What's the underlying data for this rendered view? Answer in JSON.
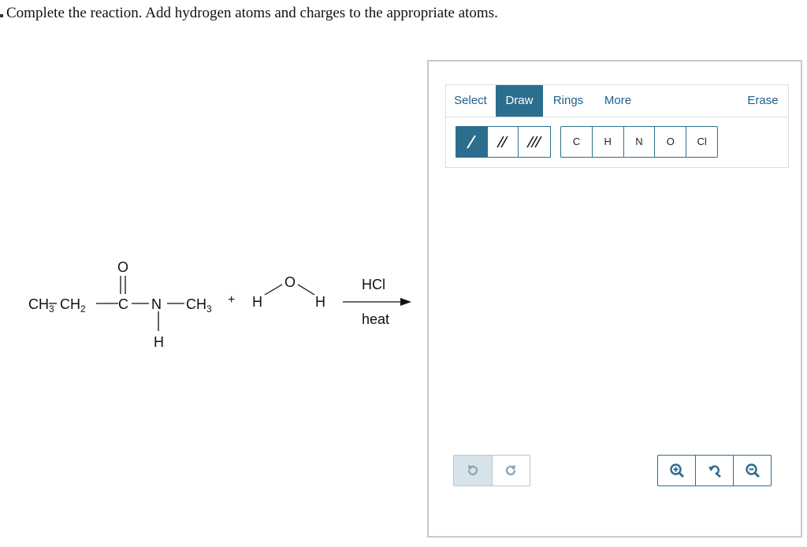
{
  "question": {
    "prompt": "Complete the reaction. Add hydrogen atoms and charges to the appropriate atoms."
  },
  "reaction": {
    "reactant1": {
      "ch3_a": "CH",
      "ch3_a_sub": "3",
      "ch2": "CH",
      "ch2_sub": "2",
      "carbon": "C",
      "oxygen": "O",
      "nitrogen": "N",
      "ch3_b": "CH",
      "ch3_b_sub": "3",
      "n_hydrogen": "H"
    },
    "plus": "+",
    "water": {
      "h_left": "H",
      "oxygen": "O",
      "h_right": "H"
    },
    "reagent_above": "HCl",
    "reagent_below": "heat"
  },
  "editor": {
    "tabs": [
      {
        "label": "Select",
        "active": false
      },
      {
        "label": "Draw",
        "active": true
      },
      {
        "label": "Rings",
        "active": false
      },
      {
        "label": "More",
        "active": false
      }
    ],
    "erase_label": "Erase",
    "bonds": [
      {
        "icon": "single-bond-icon",
        "active": true
      },
      {
        "icon": "double-bond-icon",
        "active": false
      },
      {
        "icon": "triple-bond-icon",
        "active": false
      }
    ],
    "atoms": [
      "C",
      "H",
      "N",
      "O",
      "Cl"
    ],
    "history_icons": [
      "undo-icon",
      "redo-icon"
    ],
    "zoom_icons": [
      "zoom-in-icon",
      "reset-zoom-icon",
      "zoom-out-icon"
    ],
    "accent_color": "#2b6e8e"
  }
}
